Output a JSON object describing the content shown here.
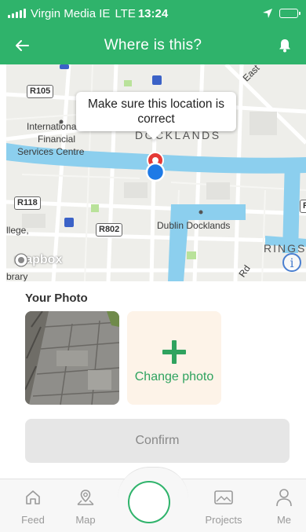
{
  "status_bar": {
    "carrier": "Virgin Media IE",
    "network": "LTE",
    "time": "13:24"
  },
  "nav": {
    "title": "Where is this?",
    "back_icon": "arrow-left-icon",
    "notification_icon": "bell-icon"
  },
  "map": {
    "callout_text": "Make sure this location is correct",
    "labels": {
      "east": "East",
      "docklands": "DOCKLANDS",
      "ifsc_line1": "International",
      "ifsc_line2": "Financial",
      "ifsc_line3": "Services Centre",
      "college": "llege,",
      "dublin_docklands": "Dublin Docklands",
      "rings": "RINGS",
      "library": "brary",
      "road_rd": "Rd"
    },
    "road_shields": {
      "r105": "R105",
      "r118": "R118",
      "r802": "R802",
      "r_edge": "R"
    },
    "attribution": "mapbox",
    "info_glyph": "i",
    "colors": {
      "water": "#8ccfee",
      "land": "#eeeeea",
      "park": "#b9e29a",
      "pin_red": "#e53935",
      "pin_blue": "#1e7ae6"
    }
  },
  "photo_section": {
    "title": "Your Photo",
    "change_photo_label": "Change photo"
  },
  "confirm": {
    "label": "Confirm"
  },
  "tabs": [
    {
      "label": "Feed",
      "icon": "home-icon"
    },
    {
      "label": "Map",
      "icon": "map-pin-icon"
    },
    {
      "label": "Projects",
      "icon": "image-icon"
    },
    {
      "label": "Me",
      "icon": "person-icon"
    }
  ],
  "accent_color": "#2fb36b"
}
